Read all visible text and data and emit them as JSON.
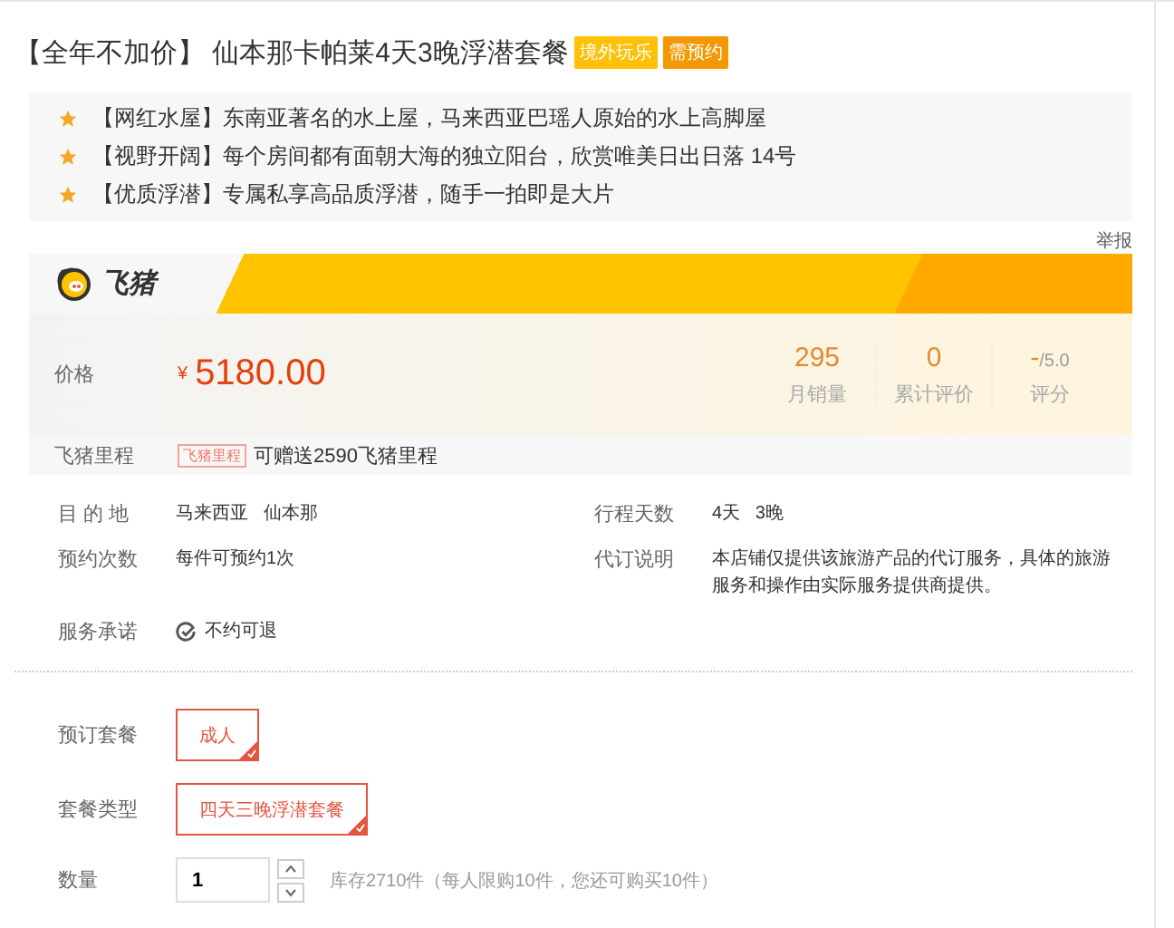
{
  "title": {
    "prefix": "【全年不加价】",
    "text": "仙本那卡帕莱4天3晚浮潜套餐",
    "tags": [
      {
        "label": "境外玩乐",
        "color": "#ffc107"
      },
      {
        "label": "需预约",
        "color": "#f39800"
      }
    ]
  },
  "highlights": [
    {
      "tag": "【网红水屋】",
      "text": "东南亚著名的水上屋，马来西亚巴瑶人原始的水上高脚屋"
    },
    {
      "tag": "【视野开阔】",
      "text": "每个房间都有面朝大海的独立阳台，欣赏唯美日出日落 14号"
    },
    {
      "tag": "【优质浮潜】",
      "text": "专属私享高品质浮潜，随手一拍即是大片"
    }
  ],
  "report_link": "举报",
  "brand": {
    "name": "飞猪"
  },
  "price": {
    "label": "价格",
    "currency": "¥",
    "amount": "5180.00"
  },
  "stats": [
    {
      "value": "295",
      "label": "月销量"
    },
    {
      "value": "0",
      "label": "累计评价"
    },
    {
      "value": "-",
      "suffix": "/5.0",
      "label": "评分"
    }
  ],
  "mileage": {
    "label": "飞猪里程",
    "badge": "飞猪里程",
    "text": "可赠送2590飞猪里程"
  },
  "details": [
    {
      "label": "目 的 地",
      "value": "马来西亚   仙本那",
      "kind": "text"
    },
    {
      "label": "行程天数",
      "value": "4天   3晚",
      "kind": "text"
    },
    {
      "label": "预约次数",
      "value": "每件可预约1次",
      "kind": "text"
    },
    {
      "label": "代订说明",
      "value": "本店铺仅提供该旅游产品的代订服务，具体的旅游服务和操作由实际服务提供商提供。",
      "kind": "text"
    },
    {
      "label": "服务承诺",
      "value": "不约可退",
      "kind": "check"
    }
  ],
  "options": [
    {
      "label": "预订套餐",
      "choices": [
        {
          "label": "成人",
          "selected": true
        }
      ]
    },
    {
      "label": "套餐类型",
      "choices": [
        {
          "label": "四天三晚浮潜套餐",
          "selected": true
        }
      ]
    }
  ],
  "quantity": {
    "label": "数量",
    "value": "1",
    "stock_note": "库存2710件（每人限购10件，您还可购买10件）"
  }
}
